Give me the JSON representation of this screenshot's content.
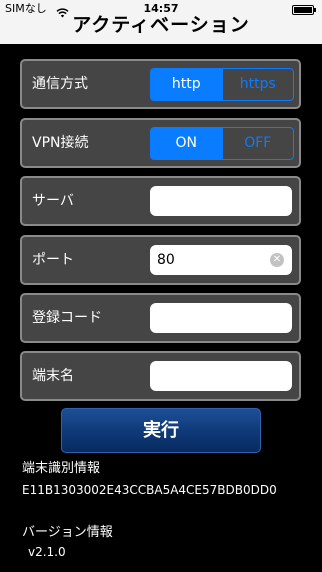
{
  "status_bar": {
    "carrier": "SIMなし",
    "time": "14:57"
  },
  "nav": {
    "title": "アクティベーション"
  },
  "protocol": {
    "label": "通信方式",
    "options": [
      "http",
      "https"
    ],
    "selected": "http"
  },
  "vpn": {
    "label": "VPN接続",
    "options": [
      "ON",
      "OFF"
    ],
    "selected": "ON"
  },
  "server": {
    "label": "サーバ",
    "value": ""
  },
  "port": {
    "label": "ポート",
    "value": "80"
  },
  "reg_code": {
    "label": "登録コード",
    "value": ""
  },
  "terminal_name": {
    "label": "端末名",
    "value": ""
  },
  "execute": {
    "label": "実行"
  },
  "device_info": {
    "label": "端末識別情報",
    "value": "E11B1303002E43CCBA5A4CE57BDB0DD0"
  },
  "version": {
    "label": "バージョン情報",
    "value": "v2.1.0"
  },
  "colors": {
    "accent": "#0a7cff",
    "row_bg": "#454545",
    "row_border": "#8a8a8a",
    "button_bg": "#0f3a7a"
  }
}
